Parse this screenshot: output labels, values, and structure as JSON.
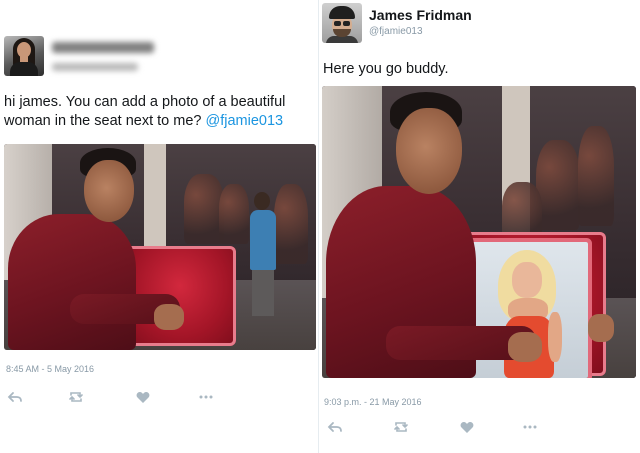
{
  "left_tweet": {
    "text_before_mention": "hi james. You can add a photo of a beautiful woman in the seat next to me? ",
    "mention": "@fjamie013",
    "timestamp": "8:45 AM - 5 May 2016",
    "icons": [
      "reply-icon",
      "retweet-icon",
      "like-icon",
      "more-icon"
    ]
  },
  "right_tweet": {
    "display_name": "James Fridman",
    "handle": "@fjamie013",
    "text": "Here you go buddy.",
    "timestamp": "9:03 p.m. - 21 May 2016",
    "icons": [
      "reply-icon",
      "retweet-icon",
      "like-icon",
      "more-icon"
    ]
  },
  "colors": {
    "mention": "#1b95e0",
    "meta_text": "#8899a6",
    "icon": "#aab8c2"
  }
}
